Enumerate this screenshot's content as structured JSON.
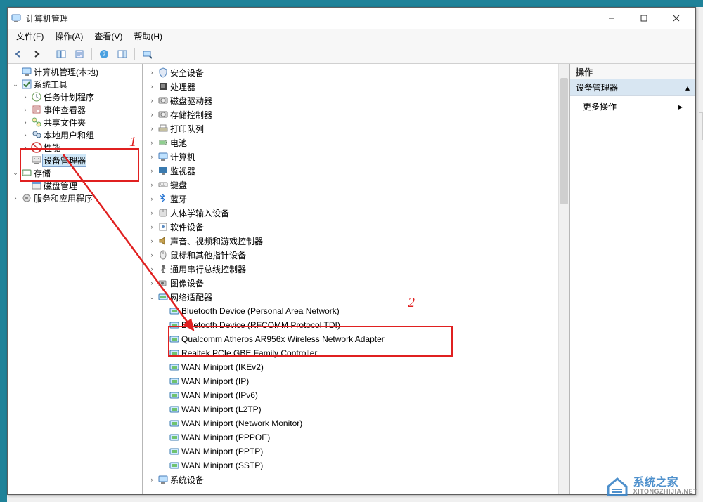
{
  "window": {
    "title": "计算机管理"
  },
  "menu": {
    "file": "文件(F)",
    "action": "操作(A)",
    "view": "查看(V)",
    "help": "帮助(H)"
  },
  "left_tree": {
    "root": "计算机管理(本地)",
    "system_tools": "系统工具",
    "task_scheduler": "任务计划程序",
    "event_viewer": "事件查看器",
    "shared_folders": "共享文件夹",
    "local_users": "本地用户和组",
    "performance": "性能",
    "device_manager": "设备管理器",
    "storage": "存储",
    "disk_mgmt": "磁盘管理",
    "services_apps": "服务和应用程序"
  },
  "mid_tree": {
    "security_devices": "安全设备",
    "processors": "处理器",
    "disk_drives": "磁盘驱动器",
    "storage_controllers": "存储控制器",
    "print_queues": "打印队列",
    "batteries": "电池",
    "computer": "计算机",
    "monitors": "监视器",
    "keyboards": "键盘",
    "bluetooth": "蓝牙",
    "hid": "人体学输入设备",
    "software_devices": "软件设备",
    "sound": "声音、视频和游戏控制器",
    "mouse": "鼠标和其他指针设备",
    "usb": "通用串行总线控制器",
    "imaging": "图像设备",
    "network_adapters": "网络适配器",
    "system_devices": "系统设备",
    "net_items": [
      "Bluetooth Device (Personal Area Network)",
      "Bluetooth Device (RFCOMM Protocol TDI)",
      "Qualcomm Atheros AR956x Wireless Network Adapter",
      "Realtek PCIe GBE Family Controller",
      "WAN Miniport (IKEv2)",
      "WAN Miniport (IP)",
      "WAN Miniport (IPv6)",
      "WAN Miniport (L2TP)",
      "WAN Miniport (Network Monitor)",
      "WAN Miniport (PPPOE)",
      "WAN Miniport (PPTP)",
      "WAN Miniport (SSTP)"
    ]
  },
  "right": {
    "header": "操作",
    "section": "设备管理器",
    "more": "更多操作"
  },
  "annotations": {
    "label1": "1",
    "label2": "2"
  },
  "watermark": {
    "brand": "系统之家",
    "url": "XITONGZHIJIA.NET"
  }
}
